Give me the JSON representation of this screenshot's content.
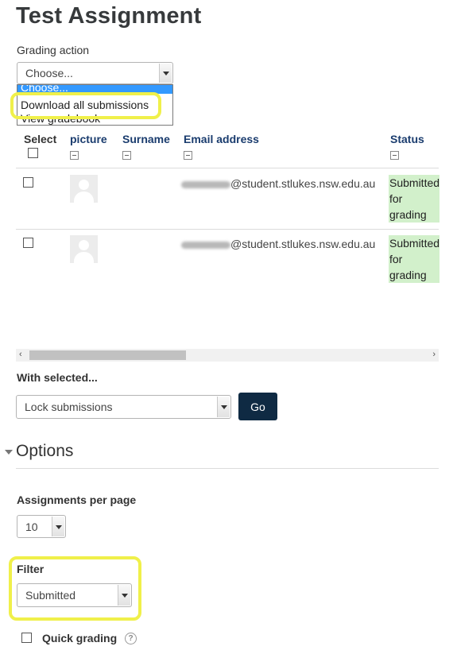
{
  "page": {
    "title": "Test Assignment"
  },
  "grading_action": {
    "label": "Grading action",
    "selected": "Choose...",
    "options": [
      "Choose...",
      "Download all submissions",
      "View gradebook"
    ]
  },
  "table": {
    "headers": {
      "select": "Select",
      "picture": "picture",
      "surname": "Surname",
      "email": "Email address",
      "status": "Status"
    },
    "rows": [
      {
        "email": "@student.stlukes.nsw.edu.au",
        "status_lines": [
          "Submitted",
          "for",
          "grading"
        ]
      },
      {
        "email": "@student.stlukes.nsw.edu.au",
        "status_lines": [
          "Submitted",
          "for",
          "grading"
        ]
      }
    ]
  },
  "scrollbar": {
    "left_arrow": "‹",
    "right_arrow": "›"
  },
  "with_selected": {
    "label": "With selected...",
    "selected": "Lock submissions",
    "go_label": "Go"
  },
  "options": {
    "heading": "Options",
    "assignments_per_page_label": "Assignments per page",
    "assignments_per_page_value": "10",
    "filter_label": "Filter",
    "filter_value": "Submitted",
    "quick_grading_label": "Quick grading",
    "help_glyph": "?"
  },
  "colors": {
    "highlight": "#f0f04a",
    "status_bg": "#d2f0cb",
    "go_button_bg": "#0f2a43",
    "header_link": "#1a3c6e",
    "dropdown_selected": "#3399ff"
  }
}
